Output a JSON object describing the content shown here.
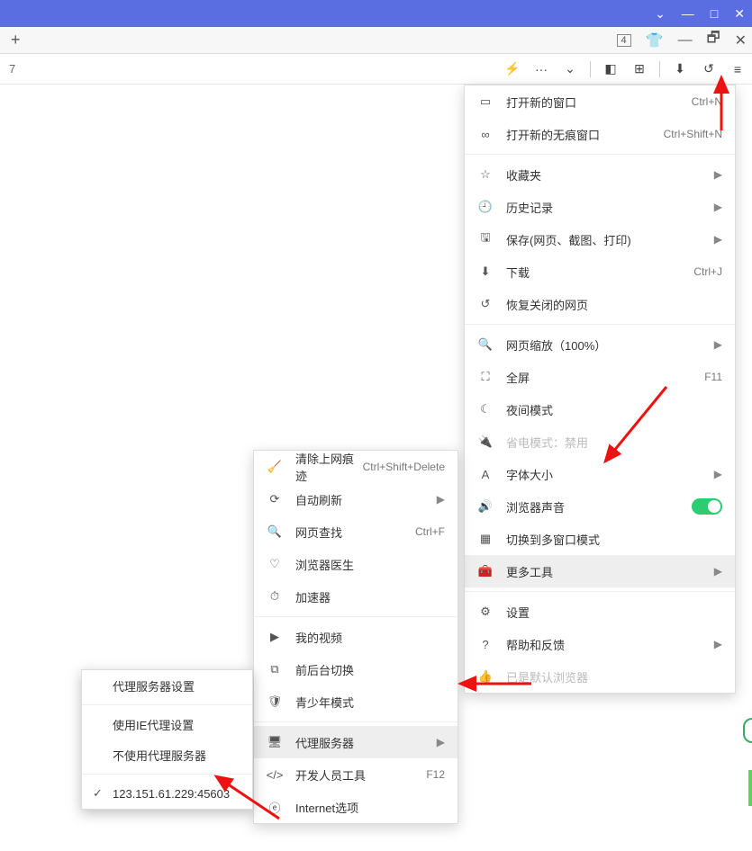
{
  "outer_window": {
    "min": "—",
    "max": "□",
    "close": "✕",
    "chevron": "⌄"
  },
  "tab_bar": {
    "new_tab": "+",
    "counter": "4",
    "ext_icon": "👕",
    "min": "—",
    "restore": "🗗",
    "close": "✕"
  },
  "toolbar": {
    "url_left": "7",
    "lightning": "⚡",
    "more": "···",
    "dropdown": "⌄",
    "sidebar": "◧",
    "grid": "⊞",
    "download": "⬇",
    "undo": "↺",
    "menu": "≡"
  },
  "main_menu": {
    "new_window": {
      "label": "打开新的窗口",
      "shortcut": "Ctrl+N"
    },
    "new_incognito": {
      "label": "打开新的无痕窗口",
      "shortcut": "Ctrl+Shift+N"
    },
    "favorites": {
      "label": "收藏夹"
    },
    "history": {
      "label": "历史记录"
    },
    "save": {
      "label": "保存(网页、截图、打印)"
    },
    "downloads": {
      "label": "下载",
      "shortcut": "Ctrl+J"
    },
    "restore_closed": {
      "label": "恢复关闭的网页"
    },
    "zoom": {
      "label": "网页缩放（100%）"
    },
    "fullscreen": {
      "label": "全屏",
      "shortcut": "F11"
    },
    "night_mode": {
      "label": "夜间模式"
    },
    "power_save": {
      "label": "省电模式：禁用"
    },
    "font_size": {
      "label": "字体大小"
    },
    "browser_sound": {
      "label": "浏览器声音"
    },
    "multi_window": {
      "label": "切换到多窗口模式"
    },
    "more_tools": {
      "label": "更多工具"
    },
    "settings": {
      "label": "设置"
    },
    "help": {
      "label": "帮助和反馈"
    },
    "default_browser": {
      "label": "已是默认浏览器"
    }
  },
  "sub_menu": {
    "clear_data": {
      "label": "清除上网痕迹",
      "shortcut": "Ctrl+Shift+Delete"
    },
    "auto_refresh": {
      "label": "自动刷新"
    },
    "find": {
      "label": "网页查找",
      "shortcut": "Ctrl+F"
    },
    "browser_doctor": {
      "label": "浏览器医生"
    },
    "accelerator": {
      "label": "加速器"
    },
    "my_videos": {
      "label": "我的视频"
    },
    "fg_bg_switch": {
      "label": "前后台切换"
    },
    "youth_mode": {
      "label": "青少年模式"
    },
    "proxy": {
      "label": "代理服务器"
    },
    "dev_tools": {
      "label": "开发人员工具",
      "shortcut": "F12"
    },
    "internet_options": {
      "label": "Internet选项"
    }
  },
  "proxy_menu": {
    "settings": "代理服务器设置",
    "use_ie": "使用IE代理设置",
    "no_proxy": "不使用代理服务器",
    "entry": "123.151.61.229:45603"
  }
}
